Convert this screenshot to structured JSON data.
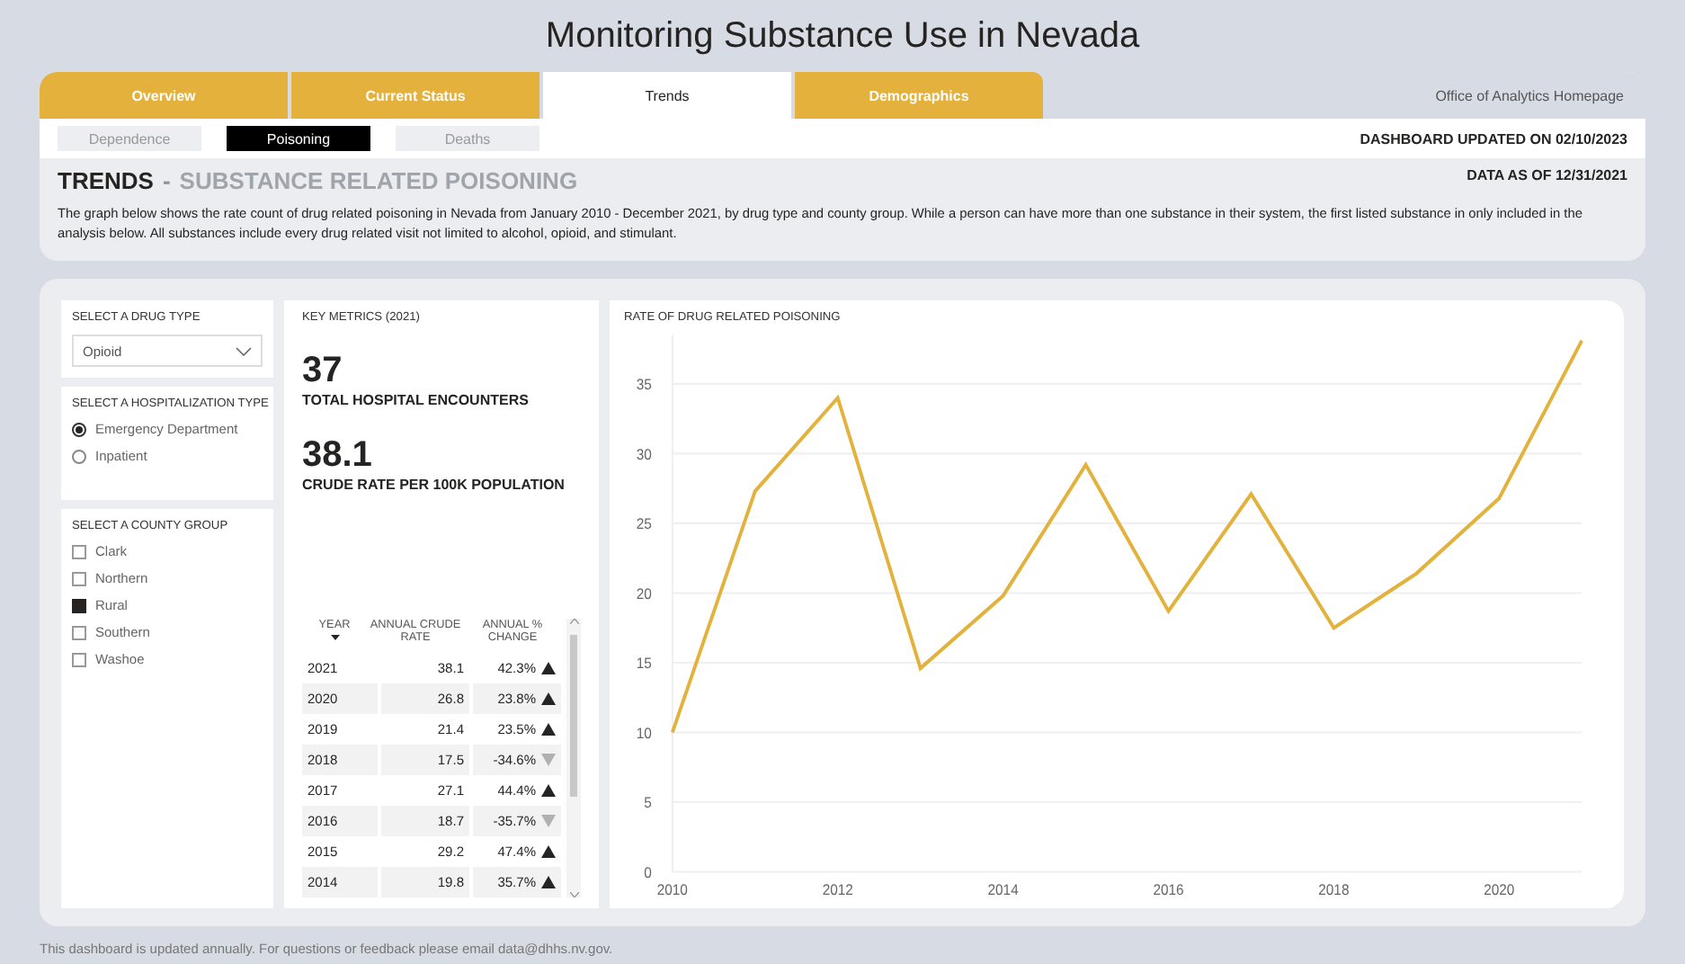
{
  "title": "Monitoring Substance Use in Nevada",
  "tabs": [
    {
      "label": "Overview",
      "selected": false
    },
    {
      "label": "Current Status",
      "selected": false
    },
    {
      "label": "Trends",
      "selected": true
    },
    {
      "label": "Demographics",
      "selected": false
    }
  ],
  "homepage_link": "Office of Analytics Homepage",
  "subtabs": [
    {
      "label": "Dependence",
      "selected": false
    },
    {
      "label": "Poisoning",
      "selected": true
    },
    {
      "label": "Deaths",
      "selected": false
    }
  ],
  "updated": "DASHBOARD UPDATED ON 02/10/2023",
  "heading": {
    "main": "TRENDS",
    "separator": "-",
    "sub": "SUBSTANCE RELATED POISONING"
  },
  "data_as_of": "DATA AS OF 12/31/2021",
  "description": "The graph below shows the rate count of drug related poisoning in Nevada from January 2010 - December 2021, by drug type and county group. While a person can have more than one substance in their system, the first listed substance in only included in the analysis below. All substances include every drug related visit not limited to alcohol, opioid, and stimulant.",
  "drug_filter": {
    "label": "SELECT A DRUG TYPE",
    "value": "Opioid"
  },
  "hospitalization_filter": {
    "label": "SELECT A HOSPITALIZATION TYPE",
    "options": [
      {
        "label": "Emergency Department",
        "selected": true
      },
      {
        "label": "Inpatient",
        "selected": false
      }
    ]
  },
  "county_filter": {
    "label": "SELECT A COUNTY GROUP",
    "options": [
      {
        "label": "Clark",
        "checked": false
      },
      {
        "label": "Northern",
        "checked": false
      },
      {
        "label": "Rural",
        "checked": true
      },
      {
        "label": "Southern",
        "checked": false
      },
      {
        "label": "Washoe",
        "checked": false
      }
    ]
  },
  "key_metrics": {
    "title": "KEY METRICS (2021)",
    "metrics": [
      {
        "value": "37",
        "label": "TOTAL HOSPITAL ENCOUNTERS"
      },
      {
        "value": "38.1",
        "label": "CRUDE RATE PER 100K POPULATION"
      }
    ]
  },
  "table": {
    "columns": [
      "YEAR",
      "ANNUAL CRUDE RATE",
      "ANNUAL % CHANGE"
    ],
    "rows": [
      {
        "year": "2021",
        "rate": "38.1",
        "change": "42.3%",
        "kind": "up"
      },
      {
        "year": "2020",
        "rate": "26.8",
        "change": "23.8%",
        "kind": "up"
      },
      {
        "year": "2019",
        "rate": "21.4",
        "change": "23.5%",
        "kind": "up"
      },
      {
        "year": "2018",
        "rate": "17.5",
        "change": "-34.6%",
        "kind": "down"
      },
      {
        "year": "2017",
        "rate": "27.1",
        "change": "44.4%",
        "kind": "up"
      },
      {
        "year": "2016",
        "rate": "18.7",
        "change": "-35.7%",
        "kind": "down"
      },
      {
        "year": "2015",
        "rate": "29.2",
        "change": "47.4%",
        "kind": "up"
      },
      {
        "year": "2014",
        "rate": "19.8",
        "change": "35.7%",
        "kind": "up"
      }
    ]
  },
  "chart": {
    "chart_data": {
      "type": "line",
      "title": "RATE OF DRUG RELATED POISONING",
      "x": [
        2010,
        2011,
        2012,
        2013,
        2014,
        2015,
        2016,
        2017,
        2018,
        2019,
        2020,
        2021
      ],
      "series": [
        {
          "color": "#e3b23c",
          "values": [
            10,
            27.3,
            34,
            14.6,
            19.8,
            29.2,
            18.7,
            27.1,
            17.5,
            21.4,
            26.8,
            38.1
          ]
        }
      ],
      "xlim": [
        2010,
        2021
      ],
      "ylim": [
        0,
        38.5
      ],
      "grid": true,
      "yticks": [
        0,
        5,
        10,
        15,
        20,
        25,
        30,
        35
      ],
      "xticks": [
        2010,
        2012,
        2014,
        2016,
        2018,
        2020
      ]
    }
  },
  "footer": "This dashboard is updated annually. For questions or feedback please email data@dhhs.nv.gov."
}
